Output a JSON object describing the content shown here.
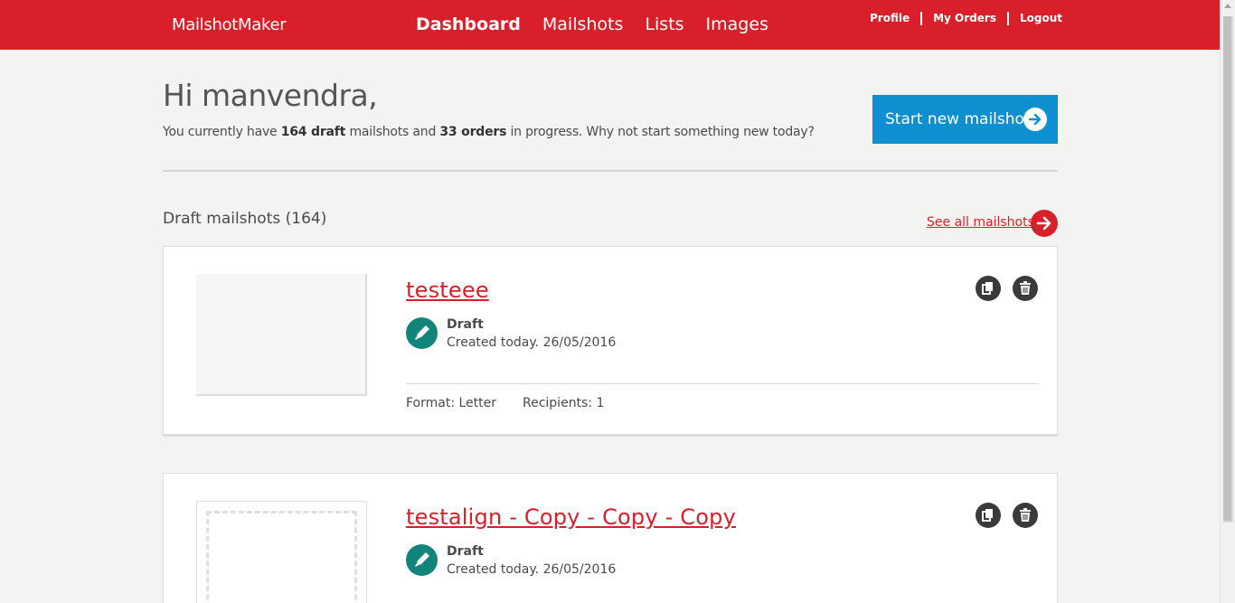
{
  "header": {
    "logo": "MailshotMaker",
    "nav": [
      "Dashboard",
      "Mailshots",
      "Lists",
      "Images"
    ],
    "active_nav": "Dashboard",
    "user_nav": [
      "Profile",
      "My Orders",
      "Logout"
    ]
  },
  "intro": {
    "greeting": "Hi manvendra,",
    "summary_pre": "You currently have ",
    "draft_count": "164 draft",
    "summary_mid": " mailshots and ",
    "order_count": "33 orders",
    "summary_post": " in progress. Why not start something new today?",
    "start_button": "Start new mailshot"
  },
  "drafts": {
    "title": "Draft mailshots (164)",
    "see_all": "See all mailshots",
    "items": [
      {
        "title": "testeee",
        "status": "Draft",
        "created": "Created today. 26/05/2016",
        "format": "Format: Letter",
        "recipients": "Recipients: 1"
      },
      {
        "title": "testalign - Copy - Copy - Copy",
        "status": "Draft",
        "created": "Created today. 26/05/2016"
      }
    ]
  },
  "colors": {
    "brand_red": "#d9202a",
    "action_blue": "#0e8fcf",
    "status_teal": "#12857a"
  }
}
